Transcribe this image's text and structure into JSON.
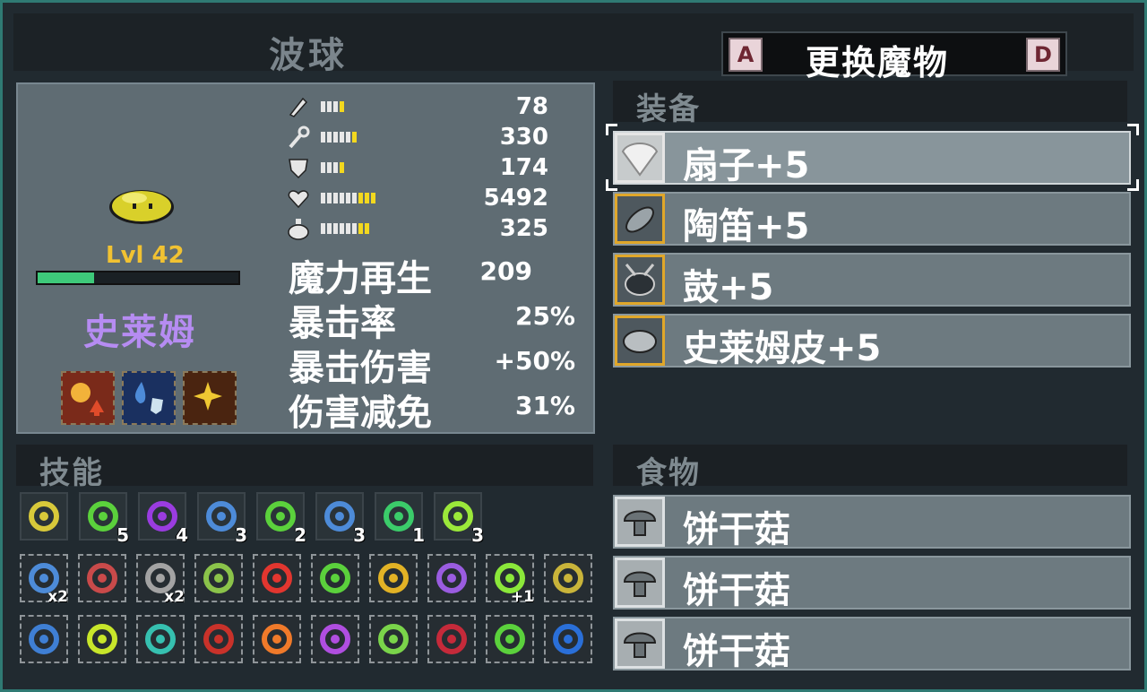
{
  "header": {
    "title": "波球",
    "swap_label": "更换魔物",
    "key_prev": "A",
    "key_next": "D"
  },
  "monster": {
    "level": "Lvl 42",
    "name": "史莱姆",
    "xp_progress": 0.28
  },
  "stats": [
    {
      "icon": "sword-icon",
      "value": "78",
      "white": 3,
      "yellow": 1
    },
    {
      "icon": "wand-icon",
      "value": "330",
      "white": 5,
      "yellow": 1
    },
    {
      "icon": "shield-icon",
      "value": "174",
      "white": 3,
      "yellow": 1
    },
    {
      "icon": "heart-icon",
      "value": "5492",
      "white": 6,
      "yellow": 3
    },
    {
      "icon": "mana-potion-icon",
      "value": "325",
      "white": 6,
      "yellow": 2
    }
  ],
  "big_stats": [
    {
      "label": "魔力再生",
      "value": "209"
    },
    {
      "label": "暴击率",
      "value": "25%"
    },
    {
      "label": "暴击伤害",
      "value": "+50%"
    },
    {
      "label": "伤害减免",
      "value": "31%"
    }
  ],
  "sections": {
    "equipment": "装备",
    "skills": "技能",
    "food": "食物"
  },
  "equipment": [
    {
      "label": "扇子+5",
      "icon": "fan-icon",
      "selected": true
    },
    {
      "label": "陶笛+5",
      "icon": "ocarina-icon",
      "selected": false
    },
    {
      "label": "鼓+5",
      "icon": "drum-icon",
      "selected": false
    },
    {
      "label": "史莱姆皮+5",
      "icon": "slime-hide-icon",
      "selected": false
    }
  ],
  "food": [
    {
      "label": "饼干菇",
      "icon": "mushroom-icon"
    },
    {
      "label": "饼干菇",
      "icon": "mushroom-icon"
    },
    {
      "label": "饼干菇",
      "icon": "mushroom-icon"
    }
  ],
  "active_skills": [
    {
      "icon": "burst-icon",
      "level": "",
      "color": "#d8c93a"
    },
    {
      "icon": "target-icon",
      "level": "5",
      "color": "#5bd13c"
    },
    {
      "icon": "claw-icon",
      "level": "4",
      "color": "#9a3ce0"
    },
    {
      "icon": "water-orb-icon",
      "level": "3",
      "color": "#4d8bd8"
    },
    {
      "icon": "rain-icon",
      "level": "2",
      "color": "#5bd13c"
    },
    {
      "icon": "water-splash-icon",
      "level": "3",
      "color": "#4d8bd8"
    },
    {
      "icon": "poison-icon",
      "level": "1",
      "color": "#3bcc6a"
    },
    {
      "icon": "wave-icon",
      "level": "3",
      "color": "#9be83a"
    }
  ],
  "passives_row1": [
    {
      "icon": "water-drop-icon",
      "level": "x2",
      "color": "#4d8bd8"
    },
    {
      "icon": "meat-icon",
      "level": "",
      "color": "#c94a4a"
    },
    {
      "icon": "stone-icon",
      "level": "x2",
      "color": "#a3a3a3"
    },
    {
      "icon": "slime-icon",
      "level": "",
      "color": "#8bc34a"
    },
    {
      "icon": "hearts-icon",
      "level": "",
      "color": "#e2362f"
    },
    {
      "icon": "heart-leaf-icon",
      "level": "",
      "color": "#5bd13c"
    },
    {
      "icon": "gold-shield-icon",
      "level": "",
      "color": "#e2b225"
    },
    {
      "icon": "purple-sword-icon",
      "level": "",
      "color": "#9a5ce0"
    },
    {
      "icon": "ring-plus-icon",
      "level": "+1",
      "color": "#8be83a"
    },
    {
      "icon": "gold-heart-icon",
      "level": "",
      "color": "#c9b43a"
    }
  ],
  "passives_row2": [
    {
      "icon": "blue-arrows-icon",
      "level": "",
      "color": "#3f7fd4"
    },
    {
      "icon": "crown-ring-icon",
      "level": "",
      "color": "#c8e62a"
    },
    {
      "icon": "eye-ring-icon",
      "level": "",
      "color": "#36c0b0"
    },
    {
      "icon": "potion-bottles-icon",
      "level": "",
      "color": "#c9322a"
    },
    {
      "icon": "fire-orb-icon",
      "level": "",
      "color": "#f07a2a"
    },
    {
      "icon": "purple-heart-icon",
      "level": "",
      "color": "#b04ee0"
    },
    {
      "icon": "green-cluster-icon",
      "level": "",
      "color": "#7ad44a"
    },
    {
      "icon": "red-mask-icon",
      "level": "",
      "color": "#c52a3a"
    },
    {
      "icon": "green-dots-icon",
      "level": "",
      "color": "#5bd13c"
    },
    {
      "icon": "blue-ring-icon",
      "level": "",
      "color": "#2a6fd8"
    }
  ]
}
